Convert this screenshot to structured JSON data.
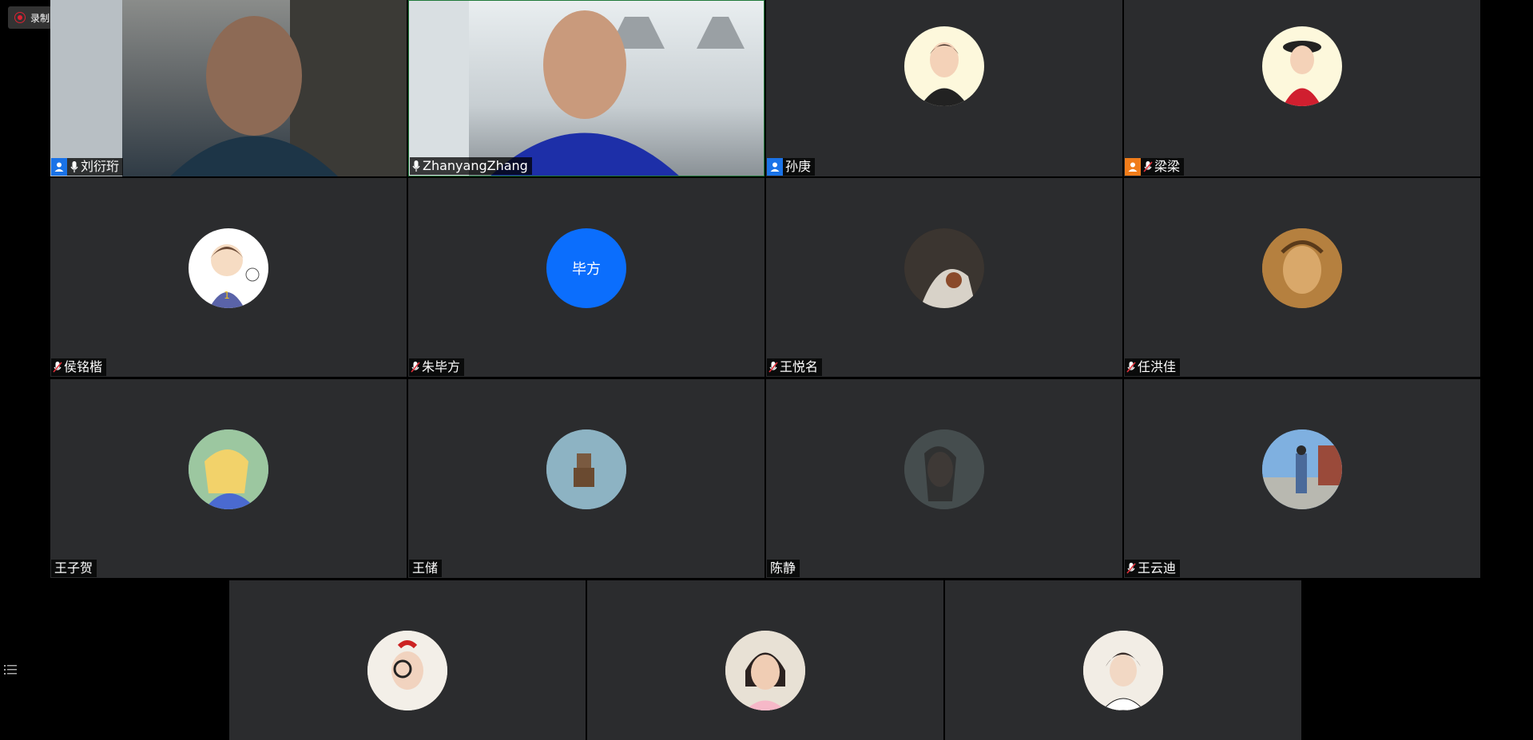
{
  "recording": {
    "label": "录制中",
    "pause_icon": "pause-icon",
    "stop_icon": "stop-icon",
    "color": "#dd2233"
  },
  "side_toggle_icon": "list-icon",
  "participants": [
    {
      "name": "刘衍珩",
      "type": "video",
      "host": true,
      "host_color": "#1a73e8",
      "mic": "on"
    },
    {
      "name": "ZhanyangZhang",
      "type": "video",
      "host": false,
      "mic": "on",
      "active_speaker": true
    },
    {
      "name": "孙庚",
      "type": "avatar",
      "host": true,
      "host_color": "#1a73e8",
      "mic": "none"
    },
    {
      "name": "梁梁",
      "type": "avatar",
      "host": true,
      "host_color": "#f07c1a",
      "mic": "muted"
    },
    {
      "name": "侯铭楷",
      "type": "avatar",
      "mic": "muted"
    },
    {
      "name": "朱毕方",
      "type": "initials",
      "initials": "毕方",
      "mic": "muted"
    },
    {
      "name": "王悦名",
      "type": "avatar",
      "mic": "muted"
    },
    {
      "name": "任洪佳",
      "type": "avatar",
      "mic": "muted"
    },
    {
      "name": "王子贺",
      "type": "avatar",
      "mic": "none"
    },
    {
      "name": "王储",
      "type": "avatar",
      "mic": "none"
    },
    {
      "name": "陈静",
      "type": "avatar",
      "mic": "none"
    },
    {
      "name": "王云迪",
      "type": "avatar",
      "mic": "muted"
    },
    {
      "name": "",
      "type": "avatar"
    },
    {
      "name": "",
      "type": "avatar"
    },
    {
      "name": "",
      "type": "avatar"
    }
  ],
  "colors": {
    "tile_bg": "#2b2c2e",
    "initials_bg": "#0b6efd",
    "active_border": "#1f7a3a"
  }
}
